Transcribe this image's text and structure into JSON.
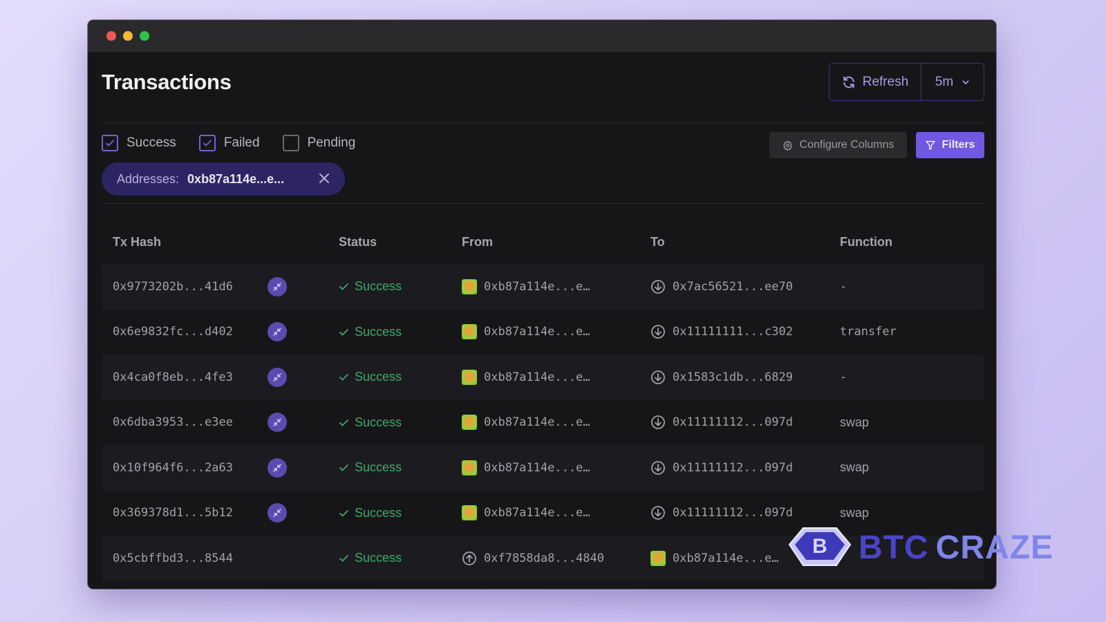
{
  "window": {
    "title": "Transactions"
  },
  "header": {
    "refresh_label": "Refresh",
    "interval_value": "5m"
  },
  "status_filters": [
    {
      "label": "Success",
      "checked": true
    },
    {
      "label": "Failed",
      "checked": true
    },
    {
      "label": "Pending",
      "checked": false
    }
  ],
  "active_filter_chip": {
    "key": "Addresses:",
    "value": "0xb87a114e...e..."
  },
  "toolbar": {
    "configure_columns_label": "Configure Columns",
    "filters_label": "Filters"
  },
  "colors": {
    "accent": "#7058e0",
    "success": "#3fa96a",
    "chip_bg": "#2d2463"
  },
  "table": {
    "columns": [
      "Tx Hash",
      "Status",
      "From",
      "To",
      "Function"
    ],
    "rows": [
      {
        "hash": "0x9773202b...41d6",
        "swap_icon": true,
        "status": "Success",
        "from": "0xb87a114e...e…",
        "from_icon": "identicon",
        "to": "0x7ac56521...ee70",
        "to_icon": "arrow-down-circle",
        "function": "-"
      },
      {
        "hash": "0x6e9832fc...d402",
        "swap_icon": true,
        "status": "Success",
        "from": "0xb87a114e...e…",
        "from_icon": "identicon",
        "to": "0x11111111...c302",
        "to_icon": "arrow-down-circle",
        "function": "transfer"
      },
      {
        "hash": "0x4ca0f8eb...4fe3",
        "swap_icon": true,
        "status": "Success",
        "from": "0xb87a114e...e…",
        "from_icon": "identicon",
        "to": "0x1583c1db...6829",
        "to_icon": "arrow-down-circle",
        "function": "-"
      },
      {
        "hash": "0x6dba3953...e3ee",
        "swap_icon": true,
        "status": "Success",
        "from": "0xb87a114e...e…",
        "from_icon": "identicon",
        "to": "0x11111112...097d",
        "to_icon": "arrow-down-circle",
        "function": "swap"
      },
      {
        "hash": "0x10f964f6...2a63",
        "swap_icon": true,
        "status": "Success",
        "from": "0xb87a114e...e…",
        "from_icon": "identicon",
        "to": "0x11111112...097d",
        "to_icon": "arrow-down-circle",
        "function": "swap"
      },
      {
        "hash": "0x369378d1...5b12",
        "swap_icon": true,
        "status": "Success",
        "from": "0xb87a114e...e…",
        "from_icon": "identicon",
        "to": "0x11111112...097d",
        "to_icon": "arrow-down-circle",
        "function": "swap"
      },
      {
        "hash": "0x5cbffbd3...8544",
        "swap_icon": false,
        "status": "Success",
        "from": "0xf7858da8...4840",
        "from_icon": "arrow-up-circle",
        "to": "0xb87a114e...e…",
        "to_icon": "identicon",
        "function": ""
      }
    ]
  },
  "watermark": {
    "part1": "BTC",
    "part2": "CRAZE"
  }
}
